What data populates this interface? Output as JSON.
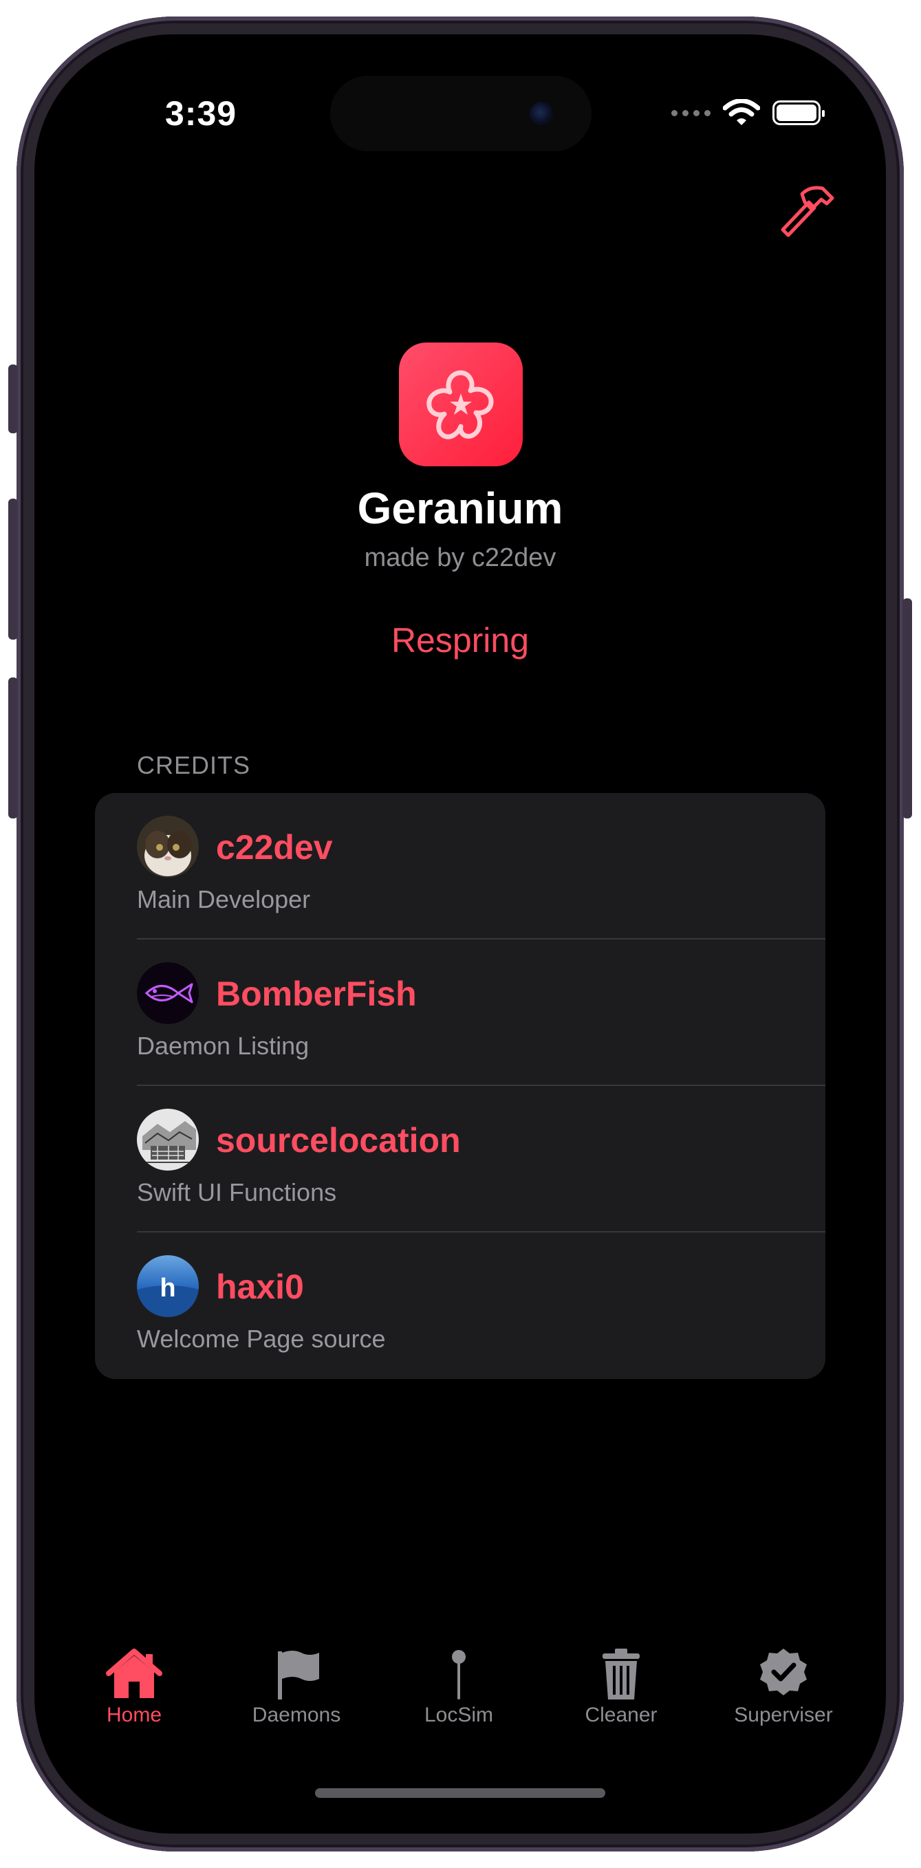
{
  "status_bar": {
    "time": "3:39"
  },
  "app": {
    "name": "Geranium",
    "subtitle": "made by c22dev",
    "respring_label": "Respring"
  },
  "credits": {
    "header": "CREDITS",
    "items": [
      {
        "name": "c22dev",
        "role": "Main Developer",
        "avatar": "cat-avatar"
      },
      {
        "name": "BomberFish",
        "role": "Daemon Listing",
        "avatar": "neon-fish-avatar"
      },
      {
        "name": "sourcelocation",
        "role": "Swift UI Functions",
        "avatar": "sketch-avatar"
      },
      {
        "name": "haxi0",
        "role": "Welcome Page source",
        "avatar": "h-letter-avatar"
      }
    ]
  },
  "tabs": [
    {
      "label": "Home",
      "icon": "house-icon",
      "active": true
    },
    {
      "label": "Daemons",
      "icon": "flag-icon",
      "active": false
    },
    {
      "label": "LocSim",
      "icon": "pin-icon",
      "active": false
    },
    {
      "label": "Cleaner",
      "icon": "trash-icon",
      "active": false
    },
    {
      "label": "Superviser",
      "icon": "checkmark-seal-icon",
      "active": false
    }
  ],
  "colors": {
    "accent": "#ff4d61",
    "background": "#000000",
    "card": "#1c1c1e",
    "secondary_text": "#8e8e93"
  }
}
